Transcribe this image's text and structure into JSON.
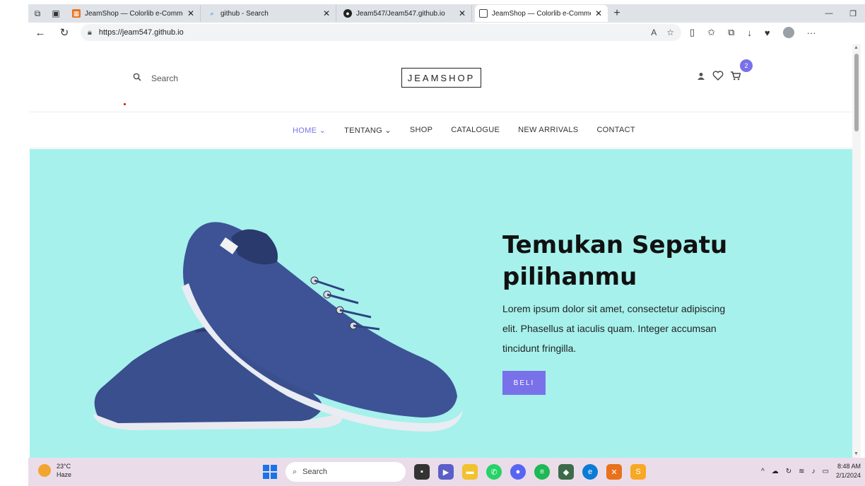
{
  "browser": {
    "tabs": [
      {
        "label": "JeamShop — Colorlib e-Commerce",
        "icon": "colorlib-icon",
        "active": false
      },
      {
        "label": "github - Search",
        "icon": "search-icon",
        "active": false
      },
      {
        "label": "Jeam547/Jeam547.github.io",
        "icon": "github-icon",
        "active": false
      },
      {
        "label": "JeamShop — Colorlib e-Commerce",
        "icon": "page-icon",
        "active": true
      }
    ],
    "url": "https://jeam547.github.io"
  },
  "site": {
    "search_label": "Search",
    "logo": "JEAMSHOP",
    "cart_count": "2",
    "nav": [
      {
        "label": "HOME",
        "active": true,
        "dropdown": true
      },
      {
        "label": "TENTANG",
        "active": false,
        "dropdown": true
      },
      {
        "label": "SHOP",
        "active": false,
        "dropdown": false
      },
      {
        "label": "CATALOGUE",
        "active": false,
        "dropdown": false
      },
      {
        "label": "NEW ARRIVALS",
        "active": false,
        "dropdown": false
      },
      {
        "label": "CONTACT",
        "active": false,
        "dropdown": false
      }
    ],
    "hero": {
      "title": "Temukan Sepatu pilihanmu",
      "text": "Lorem ipsum dolor sit amet, consectetur adipiscing elit. Phasellus at iaculis quam. Integer accumsan tincidunt fringilla.",
      "button": "BELI",
      "background": "#a6f1ec"
    },
    "accent": "#7971ea"
  },
  "taskbar": {
    "temperature": "23°C",
    "weather": "Haze",
    "search": "Search",
    "time": "8:48 AM",
    "date": "2/1/2024"
  }
}
